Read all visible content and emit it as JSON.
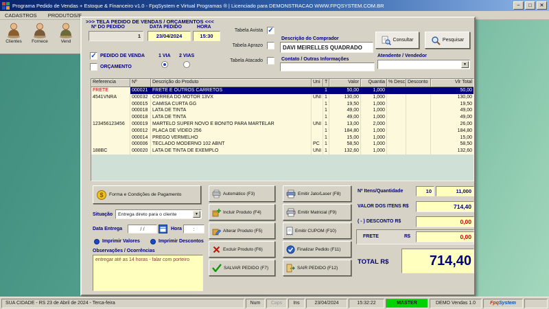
{
  "colors": {
    "accent": "#000080",
    "field_yellow": "#ffffbe",
    "negative_red": "#cc0000",
    "status_green": "#00d400",
    "selection_blue": "#000080"
  },
  "window": {
    "title": "Programa Pedido de Vendas + Estoque & Financeiro v1.0 - FpqSystem e Virtual Programas ® | Licenciado para  DEMONSTRACAO WWW.FPQSYSTEM.COM.BR",
    "controls": {
      "minimize": "−",
      "maximize": "□",
      "close": "✕"
    }
  },
  "menu": {
    "items": [
      "CADASTROS",
      "PRODUTOS/E"
    ]
  },
  "toolbar": {
    "items": [
      "Clientes",
      "Fornece",
      "Vend"
    ]
  },
  "dialog": {
    "title": ">>>  TELA PEDIDO DE VENDAS / ORÇAMENTOS  <<<",
    "header": {
      "numero_label": "Nº DO PEDIDO",
      "numero": "1",
      "data_label": "DATA PEDIDO",
      "data": "23/04/2024",
      "hora_label": "HORA",
      "hora": "15:30",
      "tabela_avista": "Tabela Avista",
      "tabela_aprazo": "Tabela Aprazo",
      "tabela_atacado": "Tabela Atacado",
      "pedido_venda": "PEDIDO DE VENDA",
      "orcamento": "ORÇAMENTO",
      "via1": "1 VIA",
      "via2": "2 VIAS",
      "comprador_label": "Descrição do Comprador",
      "comprador": "DAVI MEIRELLES QUADRADO",
      "contato_label": "Contato / Outras Informações",
      "contato": "",
      "consultar": "Consultar",
      "pesquisar": "Pesquisar",
      "atendente_label": "Atendente / Vendedor",
      "atendente": ""
    },
    "grid": {
      "columns": [
        "Referencia",
        "Nº",
        "Descrição do Produto",
        "Uni",
        "T",
        "Valor",
        "Quantia",
        "% Desc.",
        "Desconto",
        "Vlr Total"
      ],
      "selected_index": 0,
      "rows": [
        [
          "FRETE",
          "000021",
          "FRETE E OUTROS CARRETOS",
          "",
          "1",
          "50,00",
          "1,000",
          "",
          "",
          "50,00"
        ],
        [
          "4541VNRA",
          "000032",
          "CORREA DO MOTOR 13VX",
          "UNI",
          "1",
          "130,00",
          "1,000",
          "",
          "",
          "130,00"
        ],
        [
          "",
          "000015",
          "CAMISA CURTA GG",
          "",
          "1",
          "19,50",
          "1,000",
          "",
          "",
          "19,50"
        ],
        [
          "",
          "000018",
          "LATA DE TINTA",
          "",
          "1",
          "49,00",
          "1,000",
          "",
          "",
          "49,00"
        ],
        [
          "",
          "000018",
          "LATA DE TINTA",
          "",
          "1",
          "49,00",
          "1,000",
          "",
          "",
          "49,00"
        ],
        [
          "123456123456",
          "000019",
          "MARTELO SUPER NOVO E BONITO PARA MARTELAR",
          "UNI",
          "1",
          "13,00",
          "2,000",
          "",
          "",
          "26,00"
        ],
        [
          "",
          "000012",
          "PLACA DE VÍDEO 256",
          "",
          "1",
          "184,80",
          "1,000",
          "",
          "",
          "184,80"
        ],
        [
          "",
          "000014",
          "PREGO VERMELHO",
          "",
          "1",
          "15,00",
          "1,000",
          "",
          "",
          "15,00"
        ],
        [
          "",
          "000006",
          "TECLADO MODERNO 102 ABNT",
          "PC",
          "1",
          "58,50",
          "1,000",
          "",
          "",
          "58,50"
        ],
        [
          "188BC",
          "000020",
          "LATA DE TINTA DE EXEMPLO",
          "UNI",
          "1",
          "132,60",
          "1,000",
          "",
          "",
          "132,60"
        ]
      ]
    },
    "footer": {
      "payment_button": "Forma e Condições de Pagamento",
      "situacao_label": "Situação",
      "situacao": "Entrega direto para o cliente",
      "data_entrega_label": "Data Entrega",
      "data_entrega": "/  /",
      "hora_label": "Hora",
      "hora_entrega": ":",
      "imprimir_valores": "Imprimir Valores",
      "imprimir_descontos": "Imprimir Descontos",
      "observacoes_label": "Observações / Ocorrências",
      "observacoes": "entregar até as 14 horas - falar com porteiro",
      "mid_buttons": [
        "Automático (F3)",
        "Incluir Produto (F4)",
        "Alterar Produto (F5)",
        "Excluir Produto (F6)",
        "SALVAR PEDIDO (F7)"
      ],
      "right_buttons": [
        "Emitir Jato/Laser (F8)",
        "Emitir Matricial (F9)",
        "Emitir CUPOM (F10)",
        "Finalizar Pedido (F11)",
        "SAIR PEDIDO (F12)"
      ]
    },
    "totals": {
      "itens_label": "Nº Itens/Quantidade",
      "itens": "10",
      "quantidade": "11,000",
      "valor_label": "VALOR DOS ITENS R$",
      "valor": "714,40",
      "desconto_label": "( - ) DESCONTO R$",
      "desconto": "0,00",
      "frete_label": "FRETE",
      "frete_rs": "R$",
      "frete": "0,00",
      "total_label": "TOTAL R$",
      "total": "714,40"
    }
  },
  "statusbar": {
    "location": "SUA CIDADE - RS 23 de Abril de 2024 - Terca-feira",
    "num": "Num",
    "caps": "Caps",
    "ins": "Ins",
    "date": "23/04/2024",
    "time": "15:32:22",
    "user": "MASTER",
    "product": "DEMO Vendas 1.0",
    "logo_fpq": "Fpq",
    "logo_system": "System"
  }
}
